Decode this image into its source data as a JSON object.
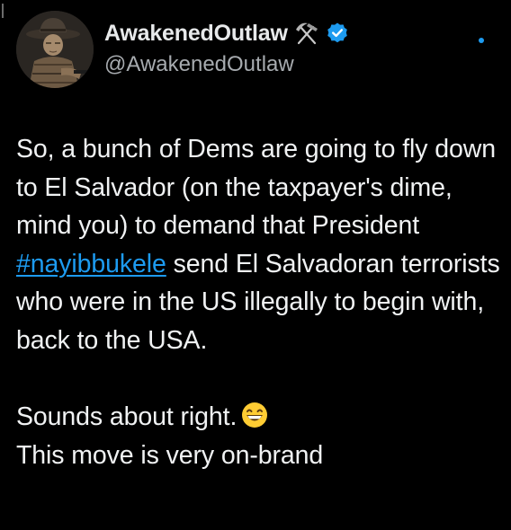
{
  "author": {
    "display_name": "AwakenedOutlaw",
    "handle": "@AwakenedOutlaw",
    "name_icon": "hammer-and-pick-icon",
    "verified_icon": "verified-badge-icon",
    "avatar": "cowboy-portrait-avatar"
  },
  "tweet": {
    "text_before_hashtag": "So, a bunch of Dems are going to fly down to El Salvador (on the taxpayer's dime, mind you) to demand that President ",
    "hashtag": "#nayibbukele",
    "text_after_hashtag": " send El Salvadoran terrorists who were in the US illegally to begin with, back to the USA.",
    "line_two": "Sounds about right.",
    "line_two_emoji": "grinning-face-emoji",
    "line_three": "This move is very on-brand"
  },
  "colors": {
    "background": "#000000",
    "text": "#e7e9ea",
    "secondary_text": "#a7abaf",
    "accent": "#1d9bf0"
  }
}
